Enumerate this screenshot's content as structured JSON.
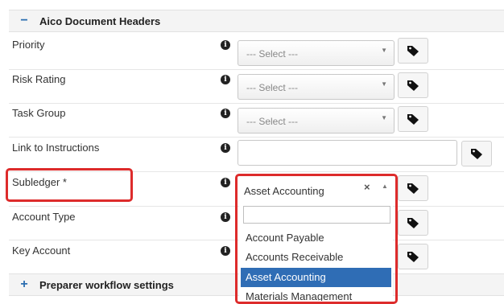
{
  "sections": [
    {
      "id": "aico",
      "toggle": "−",
      "title": "Aico Document Headers"
    },
    {
      "id": "preparer",
      "toggle": "+",
      "title": "Preparer workflow settings"
    }
  ],
  "fields": [
    {
      "label": "Priority",
      "value": "--- Select ---"
    },
    {
      "label": "Risk Rating",
      "value": "--- Select ---"
    },
    {
      "label": "Task Group",
      "value": "--- Select ---"
    },
    {
      "label": "Link to Instructions",
      "value": ""
    },
    {
      "label": "Subledger *",
      "value": "Asset Accounting"
    },
    {
      "label": "Account Type"
    },
    {
      "label": "Key Account"
    }
  ],
  "dropdown": {
    "selected": "Asset Accounting",
    "clear_glyph": "×",
    "arrow_glyph": "▲",
    "search_value": "",
    "options": [
      {
        "label": "Account Payable",
        "active": false
      },
      {
        "label": "Accounts Receivable",
        "active": false
      },
      {
        "label": "Asset Accounting",
        "active": true
      },
      {
        "label": "Materials Management",
        "active": false
      }
    ]
  },
  "icons": {
    "info": "info-circle-icon",
    "tag": "tag-icon",
    "search": "search-icon",
    "caret": "caret-down-icon"
  },
  "glyphs": {
    "info": "i",
    "caret": "▼"
  },
  "colors": {
    "highlight_red": "#dd2b2b",
    "option_active_bg": "#2f6db5",
    "toggle_blue": "#2a6db0"
  }
}
